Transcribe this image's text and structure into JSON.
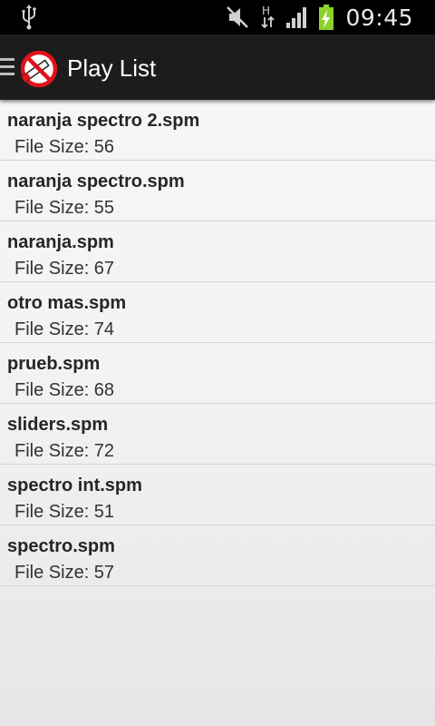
{
  "status_bar": {
    "time": "09:45",
    "network_type": "H",
    "icons": [
      "usb-icon",
      "mute-icon",
      "network-activity-icon",
      "signal-icon",
      "battery-charging-icon"
    ]
  },
  "action_bar": {
    "title": "Play List",
    "logo_icon": "no-smoking-logo-icon",
    "menu_icon": "drawer-menu-icon"
  },
  "playlist": {
    "size_prefix": "File Size: ",
    "items": [
      {
        "name": "naranja spectro 2.spm",
        "size": "File Size: 56"
      },
      {
        "name": "naranja spectro.spm",
        "size": "File Size: 55"
      },
      {
        "name": "naranja.spm",
        "size": "File Size: 67"
      },
      {
        "name": "otro mas.spm",
        "size": "File Size: 74"
      },
      {
        "name": "prueb.spm",
        "size": "File Size: 68"
      },
      {
        "name": "sliders.spm",
        "size": "File Size: 72"
      },
      {
        "name": "spectro int.spm",
        "size": "File Size: 51"
      },
      {
        "name": "spectro.spm",
        "size": "File Size: 57"
      }
    ]
  },
  "colors": {
    "status_bar_bg": "#000000",
    "action_bar_bg": "#1c1c1c",
    "battery_green": "#8cd22a",
    "logo_red": "#e0121b"
  }
}
